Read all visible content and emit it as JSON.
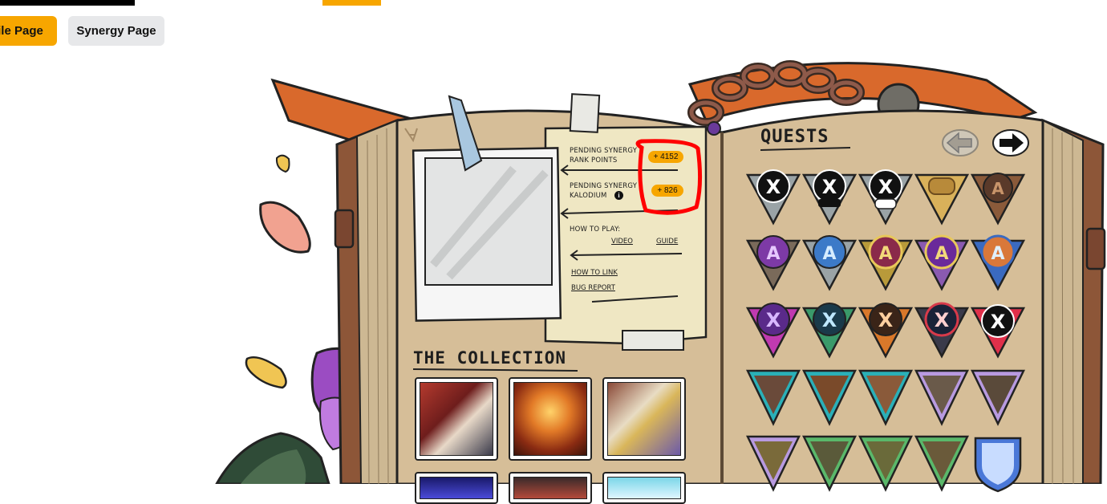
{
  "nav": {
    "profile_label": "ile Page",
    "synergy_label": "Synergy Page"
  },
  "notes": {
    "pending_rank_label": "PENDING SYNERGY RANK POINTS",
    "pending_rank_line1": "PENDING SYNERGY",
    "pending_rank_line2": "RANK POINTS",
    "pending_rank_value": "+ 4152",
    "pending_kalodium_line1": "PENDING SYNERGY",
    "pending_kalodium_line2": "KALODIUM",
    "pending_kalodium_value": "+ 826",
    "info_glyph": "i",
    "how_to_play": "HOW TO PLAY:",
    "video_link": "VIDEO",
    "guide_link": "GUIDE",
    "how_to_link": "HOW TO LINK",
    "bug_report": "BUG REPORT"
  },
  "collection": {
    "heading": "THE COLLECTION"
  },
  "quests": {
    "heading": "QUESTS",
    "prev_icon": "arrow-left-icon",
    "next_icon": "arrow-right-icon"
  },
  "colors": {
    "accent": "#f7a600",
    "highlight": "#ff0000",
    "page": "#d6be98",
    "note": "#efe7c3"
  }
}
